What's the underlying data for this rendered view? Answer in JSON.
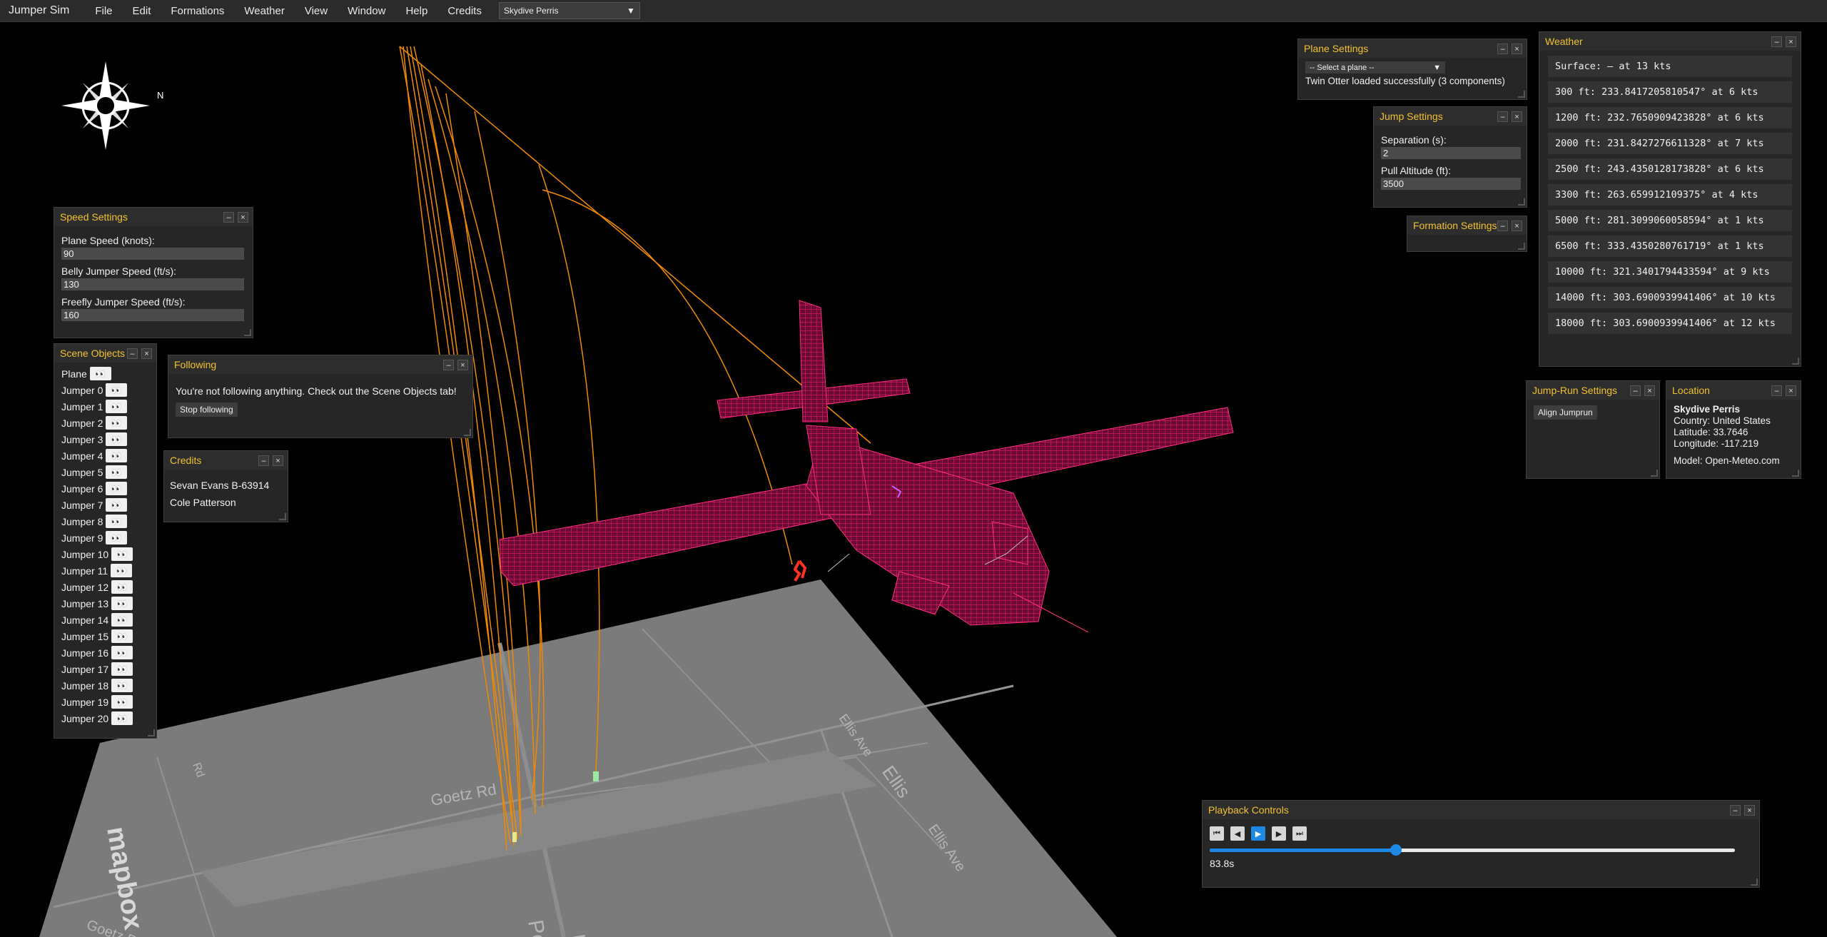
{
  "menubar": {
    "app_title": "Jumper Sim",
    "items": [
      "File",
      "Edit",
      "Formations",
      "Weather",
      "View",
      "Window",
      "Help",
      "Credits"
    ],
    "scenario": "Skydive Perris"
  },
  "map": {
    "streets": [
      "Goetz Rd",
      "Ellis Ave",
      "Ellis",
      "Ellis Ave",
      "Goetz Rd",
      "Rd",
      "Perris",
      "L"
    ],
    "logo": "mapbox"
  },
  "speed_settings": {
    "title": "Speed Settings",
    "plane_label": "Plane Speed (knots):",
    "plane_value": "90",
    "belly_label": "Belly Jumper Speed (ft/s):",
    "belly_value": "130",
    "freefly_label": "Freefly Jumper Speed (ft/s):",
    "freefly_value": "160"
  },
  "scene_objects": {
    "title": "Scene Objects",
    "items": [
      "Plane",
      "Jumper 0",
      "Jumper 1",
      "Jumper 2",
      "Jumper 3",
      "Jumper 4",
      "Jumper 5",
      "Jumper 6",
      "Jumper 7",
      "Jumper 8",
      "Jumper 9",
      "Jumper 10",
      "Jumper 11",
      "Jumper 12",
      "Jumper 13",
      "Jumper 14",
      "Jumper 15",
      "Jumper 16",
      "Jumper 17",
      "Jumper 18",
      "Jumper 19",
      "Jumper 20"
    ],
    "eye_icon": "👀"
  },
  "following": {
    "title": "Following",
    "message": "You're not following anything. Check out the Scene Objects tab!",
    "stop_label": "Stop following"
  },
  "credits": {
    "title": "Credits",
    "lines": [
      "Sevan Evans B-63914",
      "Cole Patterson"
    ]
  },
  "plane_settings": {
    "title": "Plane Settings",
    "select_placeholder": "-- Select a plane --",
    "status": "Twin Otter loaded successfully (3 components)"
  },
  "jump_settings": {
    "title": "Jump Settings",
    "separation_label": "Separation (s):",
    "separation_value": "2",
    "pull_label": "Pull Altitude (ft):",
    "pull_value": "3500"
  },
  "formation_settings": {
    "title": "Formation Settings"
  },
  "weather": {
    "title": "Weather",
    "rows": [
      "Surface: — at 13 kts",
      "300 ft: 233.8417205810547° at 6 kts",
      "1200 ft: 232.7650909423828° at 6 kts",
      "2000 ft: 231.8427276611328° at 7 kts",
      "2500 ft: 243.4350128173828° at 6 kts",
      "3300 ft: 263.659912109375° at 4 kts",
      "5000 ft: 281.3099060058594° at 1 kts",
      "6500 ft: 333.4350280761719° at 1 kts",
      "10000 ft: 321.3401794433594° at 9 kts",
      "14000 ft: 303.6900939941406° at 10 kts",
      "18000 ft: 303.6900939941406° at 12 kts"
    ]
  },
  "jumprun_settings": {
    "title": "Jump-Run Settings",
    "align_label": "Align Jumprun"
  },
  "location": {
    "title": "Location",
    "name": "Skydive Perris",
    "country": "Country: United States",
    "latitude": "Latitude: 33.7646",
    "longitude": "Longitude: -117.219",
    "model": "Model: Open-Meteo.com"
  },
  "playback": {
    "title": "Playback Controls",
    "time": "83.8s",
    "progress": 0.355
  },
  "colors": {
    "accent": "#f2c230",
    "plane": "#c8145a",
    "trail": "#f08a00",
    "slider": "#1e88e5"
  }
}
